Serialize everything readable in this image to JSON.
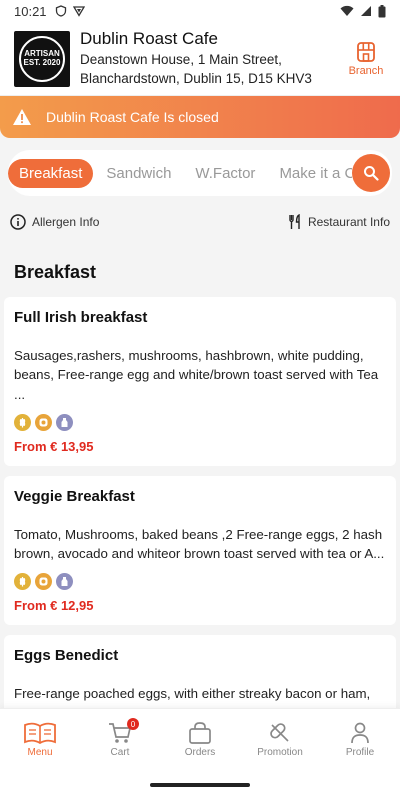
{
  "status_bar": {
    "time": "10:21"
  },
  "header": {
    "logo_text": "ARTISAN EST. 2020",
    "shop_name": "Dublin Roast Cafe",
    "address_line1": "Deanstown House, 1 Main Street,",
    "address_line2": "Blanchardstown, Dublin 15, D15 KHV3",
    "branch_label": "Branch"
  },
  "banner": {
    "text": "Dublin Roast Cafe Is closed"
  },
  "categories": {
    "tabs": [
      "Breakfast",
      "Sandwich",
      "W.Factor",
      "Make it a C"
    ],
    "active_index": 0
  },
  "info": {
    "allergen_label": "Allergen Info",
    "restaurant_label": "Restaurant Info"
  },
  "section": {
    "title": "Breakfast"
  },
  "items": [
    {
      "title": "Full Irish breakfast",
      "description": "Sausages,rashers, mushrooms, hashbrown, white pudding, beans, Free-range egg and white/brown toast served with Tea ...",
      "price": "From € 13,95"
    },
    {
      "title": "Veggie Breakfast",
      "description": "Tomato, Mushrooms, baked beans ,2 Free-range eggs, 2 hash brown, avocado and whiteor brown toast served with tea or A...",
      "price": "From € 12,95"
    },
    {
      "title": "Eggs Benedict",
      "description": "Free-range poached eggs, with either streaky bacon or ham,"
    }
  ],
  "allergen_icons": [
    "wheat-icon",
    "egg-icon",
    "milk-icon"
  ],
  "colors": {
    "accent": "#ef6d3a",
    "price": "#e02a1f",
    "banner_start": "#f39c4b",
    "banner_end": "#ef6b4c"
  },
  "bottom_nav": {
    "menu": "Menu",
    "cart": "Cart",
    "cart_count": "0",
    "orders": "Orders",
    "promotion": "Promotion",
    "profile": "Profile"
  }
}
